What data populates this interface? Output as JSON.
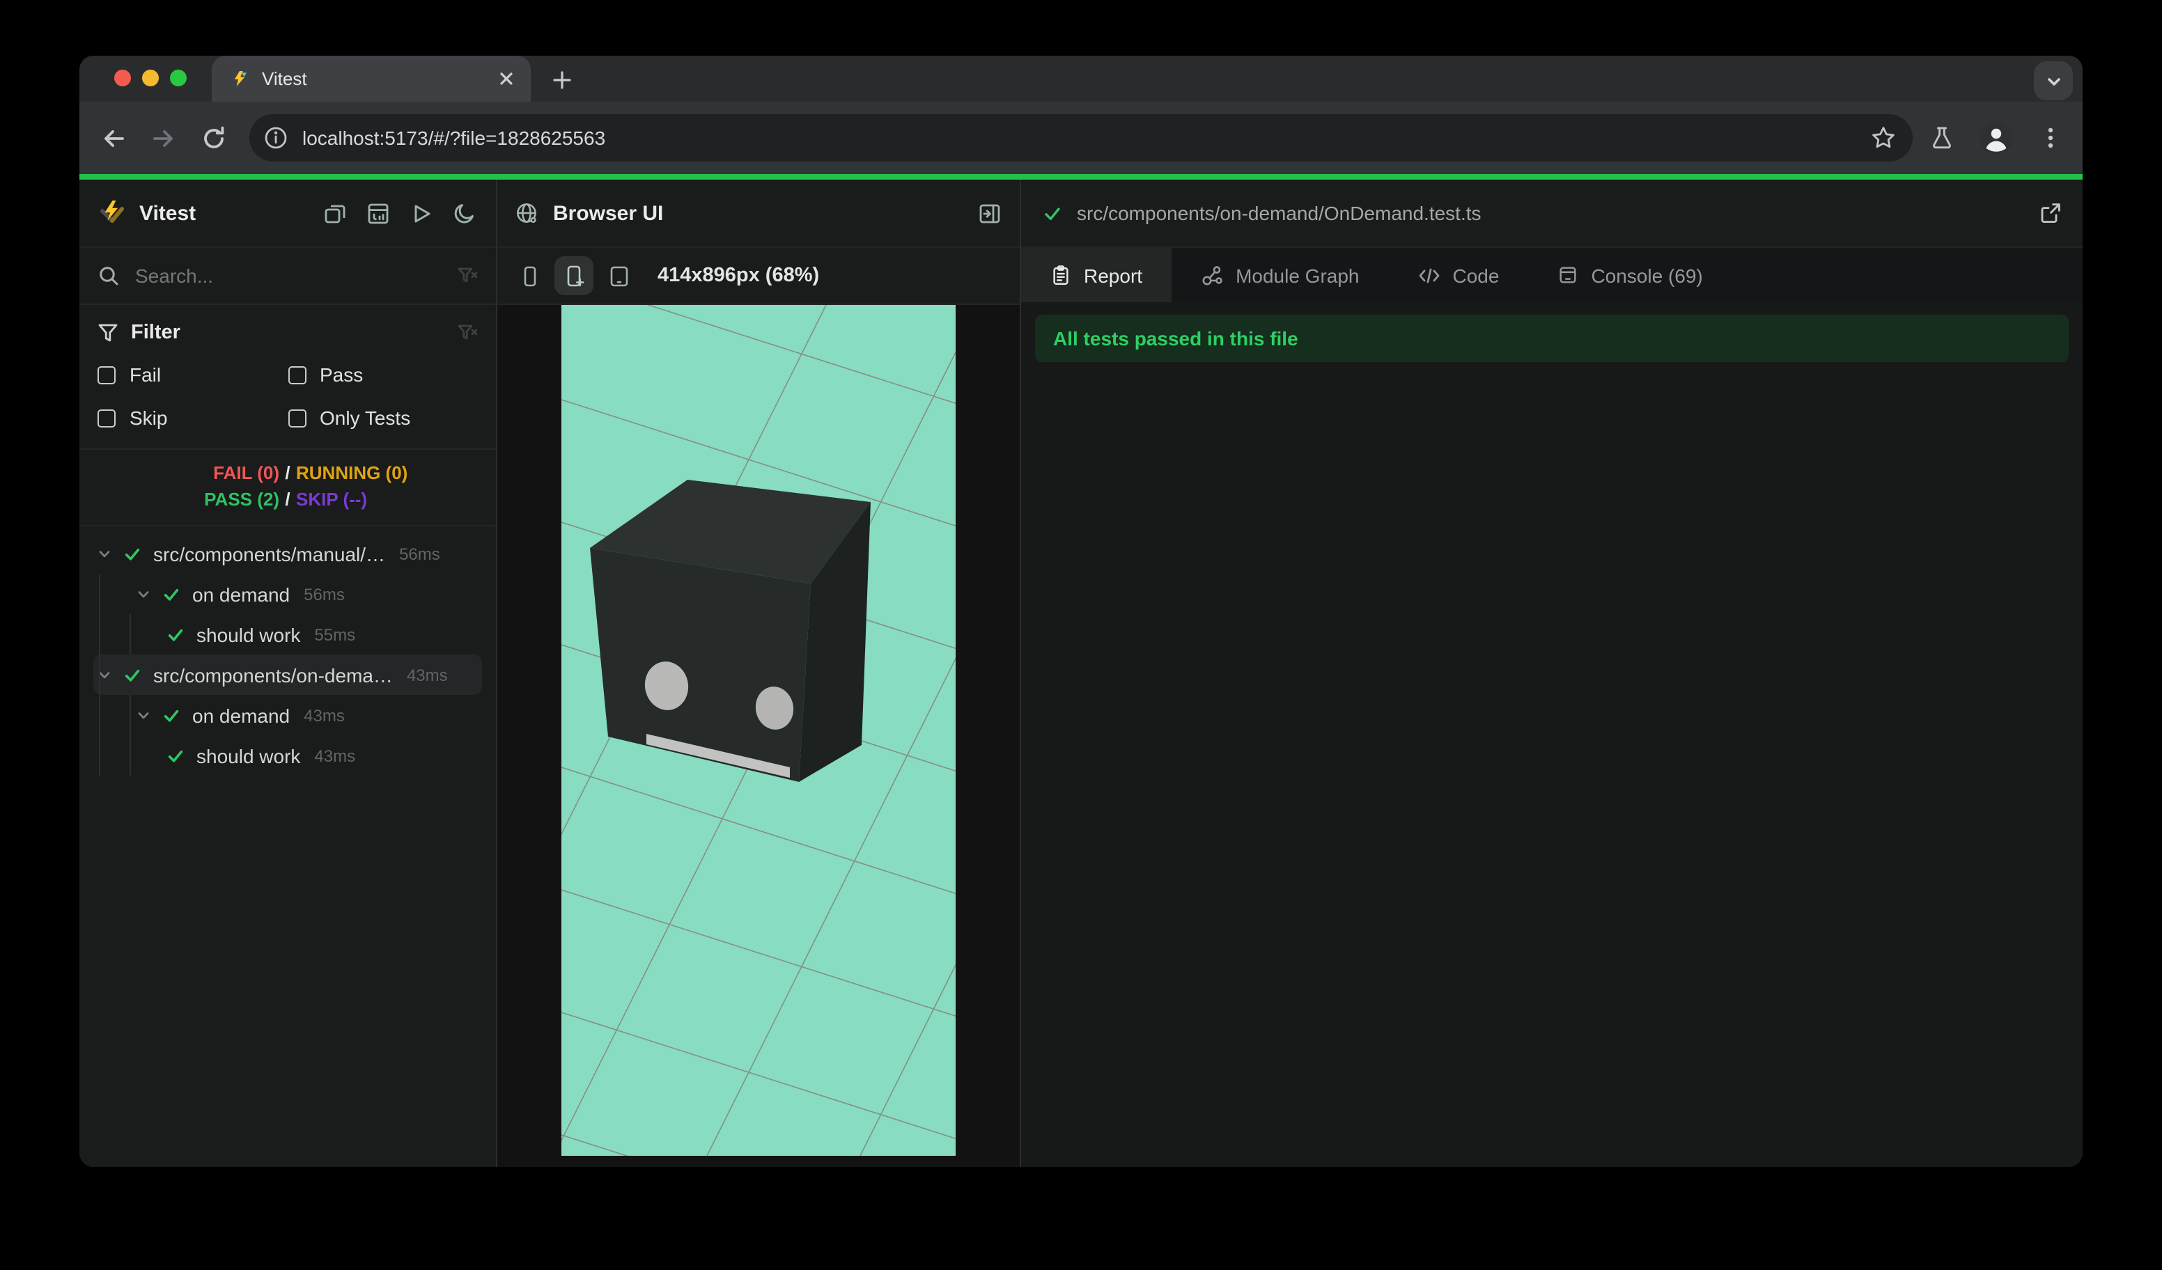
{
  "browser": {
    "tab_title": "Vitest",
    "url": "localhost:5173/#/?file=1828625563"
  },
  "sidebar": {
    "title": "Vitest",
    "search_placeholder": "Search...",
    "filter": {
      "title": "Filter",
      "options": [
        "Fail",
        "Pass",
        "Skip",
        "Only Tests"
      ]
    },
    "summary": {
      "fail": "FAIL (0)",
      "running": "RUNNING (0)",
      "pass": "PASS (2)",
      "skip": "SKIP (--)",
      "sep": "/"
    },
    "tree": [
      {
        "label": "src/components/manual/…",
        "duration": "56ms"
      },
      {
        "label": "on demand",
        "duration": "56ms"
      },
      {
        "label": "should work",
        "duration": "55ms"
      },
      {
        "label": "src/components/on-dema…",
        "duration": "43ms"
      },
      {
        "label": "on demand",
        "duration": "43ms"
      },
      {
        "label": "should work",
        "duration": "43ms"
      }
    ]
  },
  "preview": {
    "title": "Browser UI",
    "dimensions": "414x896px (68%)"
  },
  "detail": {
    "file_path": "src/components/on-demand/OnDemand.test.ts",
    "tabs": [
      {
        "label": "Report"
      },
      {
        "label": "Module Graph"
      },
      {
        "label": "Code"
      },
      {
        "label": "Console (69)"
      }
    ],
    "banner": "All tests passed in this file"
  },
  "colors": {
    "progress_green": "#27c148",
    "pass_green": "#2fc162",
    "fail_red": "#f05656",
    "running_amber": "#dfa412",
    "skip_purple": "#7a3bd0",
    "banner_bg": "#152e1e",
    "banner_text": "#2fcf63",
    "viewport_teal": "#87dcc1",
    "vitest_yellow": "#fcc72b"
  }
}
